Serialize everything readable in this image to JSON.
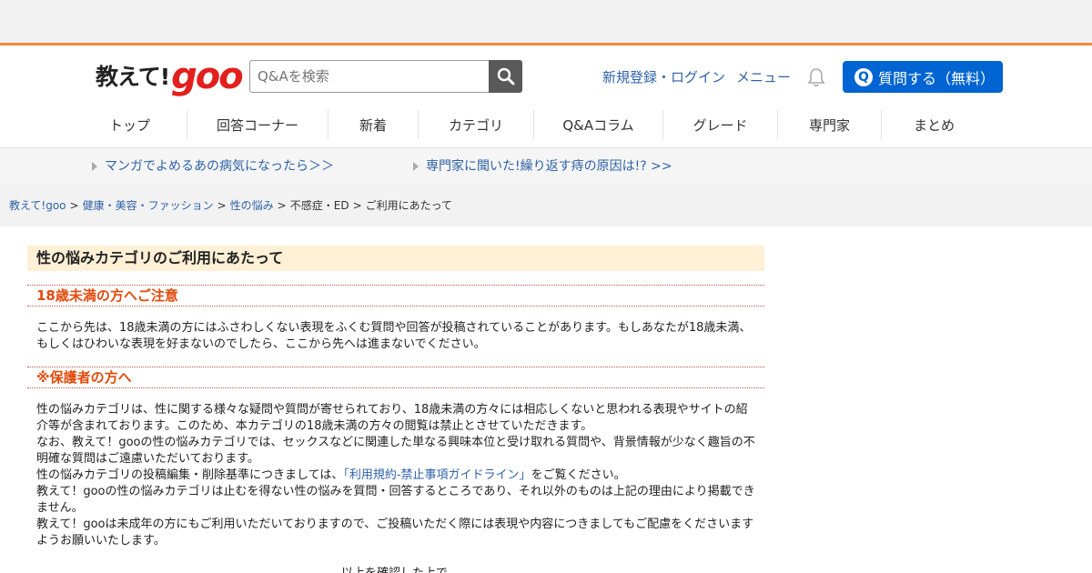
{
  "header": {
    "logo_text": "教えて!",
    "logo_brand": "goo",
    "search_placeholder": "Q&Aを検索",
    "register_login": "新規登録・ログイン",
    "menu": "メニュー",
    "ask_button": "質問する（無料）",
    "ask_icon": "Q"
  },
  "nav": [
    {
      "label": "トップ"
    },
    {
      "label": "回答コーナー"
    },
    {
      "label": "新着"
    },
    {
      "label": "カテゴリ"
    },
    {
      "label": "Q&Aコラム"
    },
    {
      "label": "グレード"
    },
    {
      "label": "専門家"
    },
    {
      "label": "まとめ"
    }
  ],
  "promo": [
    {
      "label": "マンガでよめるあの病気になったら＞＞"
    },
    {
      "label": "専門家に聞いた!繰り返す痔の原因は!? >>"
    }
  ],
  "breadcrumb": {
    "items": [
      "教えて!goo",
      "健康・美容・ファッション",
      "性の悩み",
      "不感症・ED",
      "ご利用にあたって"
    ],
    "separator": ">"
  },
  "main": {
    "title": "性の悩みカテゴリのご利用にあたって",
    "section1_heading": "18歳未満の方へご注意",
    "section1_lines": [
      "ここから先は、18歳未満の方にはふさわしくない表現をふくむ質問や回答が投稿されていることがあります。もしあなたが18歳未満、",
      "もしくはひわいな表現を好まないのでしたら、ここから先へは進まないでください。"
    ],
    "section2_heading": "※保護者の方へ",
    "section2_lines": [
      "性の悩みカテゴリは、性に関する様々な疑問や質問が寄せられており、18歳未満の方々には相応しくないと思われる表現やサイトの紹",
      "介等が含まれております。このため、本カテゴリの18歳未満の方々の閲覧は禁止とさせていただきます。",
      "なお、教えて！gooの性の悩みカテゴリでは、セックスなどに関連した単なる興味本位と受け取れる質問や、背景情報が少なく趣旨の不",
      "明確な質問はご遠慮いただいております。"
    ],
    "guideline_prefix": "性の悩みカテゴリの投稿編集・削除基準につきましては、",
    "guideline_link": "「利用規約-禁止事項ガイドライン」",
    "guideline_suffix": "をご覧ください。",
    "section2_more_lines": [
      "教えて！gooの性の悩みカテゴリは止むを得ない性の悩みを質問・回答するところであり、それ以外のものは上記の理由により掲載でき",
      "ません。",
      "教えて！gooは未成年の方にもご利用いただいておりますので、ご投稿いただく際には表現や内容につきましてもご配慮をくださいます",
      "ようお願いいたします。"
    ],
    "confirm_text": "以上を確認した上で"
  },
  "colors": {
    "accent_orange": "#f7883d",
    "brand_red": "#e2201d",
    "link_blue": "#2f62a8",
    "ask_blue": "#0064d2",
    "heading_orange": "#e24a0d",
    "title_bg": "#fff0d6"
  }
}
